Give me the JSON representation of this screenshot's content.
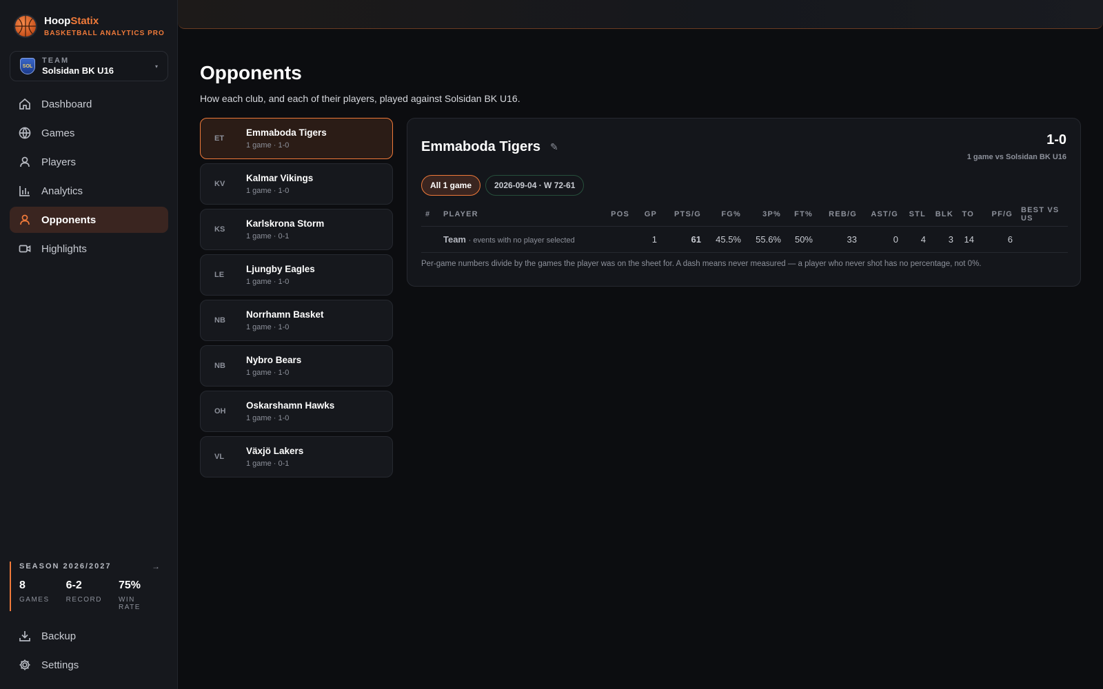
{
  "brand": {
    "name_a": "Hoop",
    "name_b": "Statix",
    "subtitle": "BASKETBALL ANALYTICS PRO"
  },
  "team": {
    "label": "TEAM",
    "name": "Solsidan BK U16",
    "crest_text": "SOL"
  },
  "nav": [
    {
      "label": "Dashboard",
      "icon": "home-icon"
    },
    {
      "label": "Games",
      "icon": "globe-icon"
    },
    {
      "label": "Players",
      "icon": "user-icon"
    },
    {
      "label": "Analytics",
      "icon": "bar-chart-icon"
    },
    {
      "label": "Opponents",
      "icon": "user-icon",
      "active": true
    },
    {
      "label": "Highlights",
      "icon": "video-icon"
    }
  ],
  "season": {
    "title": "SEASON 2026/2027",
    "games": "8",
    "games_label": "GAMES",
    "record": "6-2",
    "record_label": "RECORD",
    "win_rate": "75%",
    "win_rate_label": "WIN RATE"
  },
  "bottom_nav": [
    {
      "label": "Backup",
      "icon": "download-icon"
    },
    {
      "label": "Settings",
      "icon": "gear-icon"
    }
  ],
  "page": {
    "title": "Opponents",
    "subtitle": "How each club, and each of their players, played against Solsidan BK U16."
  },
  "opponents": [
    {
      "abbr": "ET",
      "name": "Emmaboda Tigers",
      "meta": "1 game · 1-0",
      "active": true
    },
    {
      "abbr": "KV",
      "name": "Kalmar Vikings",
      "meta": "1 game · 1-0"
    },
    {
      "abbr": "KS",
      "name": "Karlskrona Storm",
      "meta": "1 game · 0-1"
    },
    {
      "abbr": "LE",
      "name": "Ljungby Eagles",
      "meta": "1 game · 1-0"
    },
    {
      "abbr": "NB",
      "name": "Norrhamn Basket",
      "meta": "1 game · 1-0"
    },
    {
      "abbr": "NB",
      "name": "Nybro Bears",
      "meta": "1 game · 1-0"
    },
    {
      "abbr": "OH",
      "name": "Oskarshamn Hawks",
      "meta": "1 game · 1-0"
    },
    {
      "abbr": "VL",
      "name": "Växjö Lakers",
      "meta": "1 game · 0-1"
    }
  ],
  "detail": {
    "title": "Emmaboda Tigers",
    "record": "1-0",
    "record_sub": "1 game vs Solsidan BK U16",
    "chip_all": "All 1 game",
    "chip_game": "2026-09-04 · W 72-61",
    "columns": [
      "#",
      "PLAYER",
      "POS",
      "GP",
      "PTS/G",
      "FG%",
      "3P%",
      "FT%",
      "REB/G",
      "AST/G",
      "STL",
      "BLK",
      "TO",
      "PF/G",
      "BEST VS US"
    ],
    "row": {
      "num": "",
      "player": "Team",
      "note": "· events with no player selected",
      "pos": "",
      "gp": "1",
      "pts": "61",
      "fg": "45.5%",
      "three": "55.6%",
      "ft": "50%",
      "reb": "33",
      "ast": "0",
      "stl": "4",
      "blk": "3",
      "to": "14",
      "pf": "6",
      "best": ""
    },
    "footnote": "Per-game numbers divide by the games the player was on the sheet for. A dash means never measured — a player who never shot has no percentage, not 0%."
  },
  "colors": {
    "accent": "#f07a3a",
    "background": "#0c0d10",
    "panel": "#16181d"
  }
}
